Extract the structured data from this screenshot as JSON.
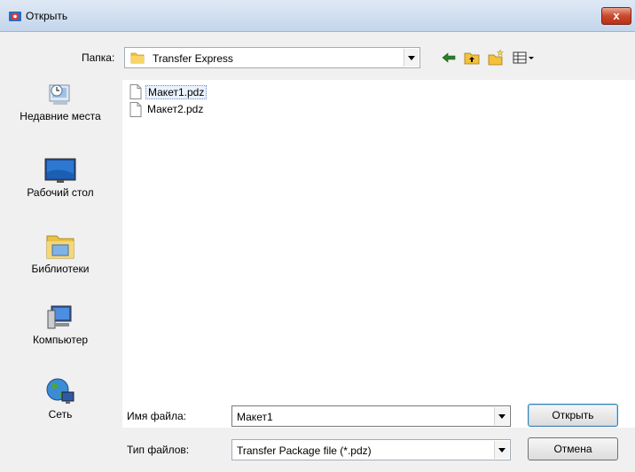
{
  "window": {
    "title": "Открыть",
    "close_label": "x"
  },
  "folder_bar": {
    "label": "Папка:",
    "current_folder": "Transfer Express",
    "toolbar_icons": [
      "back-arrow-icon",
      "up-folder-icon",
      "new-folder-icon",
      "view-menu-icon"
    ]
  },
  "places": [
    {
      "label": "Недавние места",
      "icon": "recent-places-icon"
    },
    {
      "label": "Рабочий стол",
      "icon": "desktop-icon"
    },
    {
      "label": "Библиотеки",
      "icon": "libraries-icon"
    },
    {
      "label": "Компьютер",
      "icon": "computer-icon"
    },
    {
      "label": "Сеть",
      "icon": "network-icon"
    }
  ],
  "files": [
    {
      "name": "Макет1.pdz",
      "selected": true
    },
    {
      "name": "Макет2.pdz",
      "selected": false
    }
  ],
  "file_name": {
    "label": "Имя файла:",
    "value": "Макет1"
  },
  "file_type": {
    "label": "Тип файлов:",
    "value": "Transfer Package file (*.pdz)"
  },
  "buttons": {
    "open": "Открыть",
    "cancel": "Отмена"
  }
}
